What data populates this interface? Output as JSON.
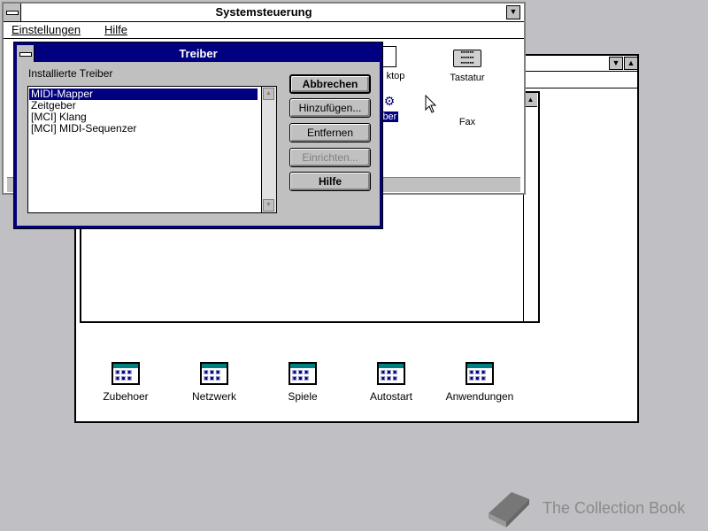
{
  "systemsteuerung": {
    "title": "Systemsteuerung",
    "menu": [
      "Einstellungen",
      "Hilfe"
    ],
    "icons": [
      {
        "label": "ktop",
        "icon": "desktop-icon"
      },
      {
        "label": "Tastatur",
        "icon": "keyboard-icon"
      },
      {
        "label": "iber",
        "icon": "drivers-icon"
      },
      {
        "label": "Fax",
        "icon": "fax-icon"
      }
    ]
  },
  "program_manager": {
    "groups": [
      "Zubehoer",
      "Netzwerk",
      "Spiele",
      "Autostart",
      "Anwendungen"
    ]
  },
  "dialog": {
    "title": "Treiber",
    "list_label": "Installierte Treiber",
    "items": [
      "MIDI-Mapper",
      "Zeitgeber",
      "[MCI] Klang",
      "[MCI] MIDI-Sequenzer"
    ],
    "selected": "MIDI-Mapper",
    "buttons": {
      "cancel": "Abbrechen",
      "add": "Hinzufügen...",
      "remove": "Entfernen",
      "setup": "Einrichten...",
      "help": "Hilfe"
    }
  },
  "watermark": "The Collection Book"
}
